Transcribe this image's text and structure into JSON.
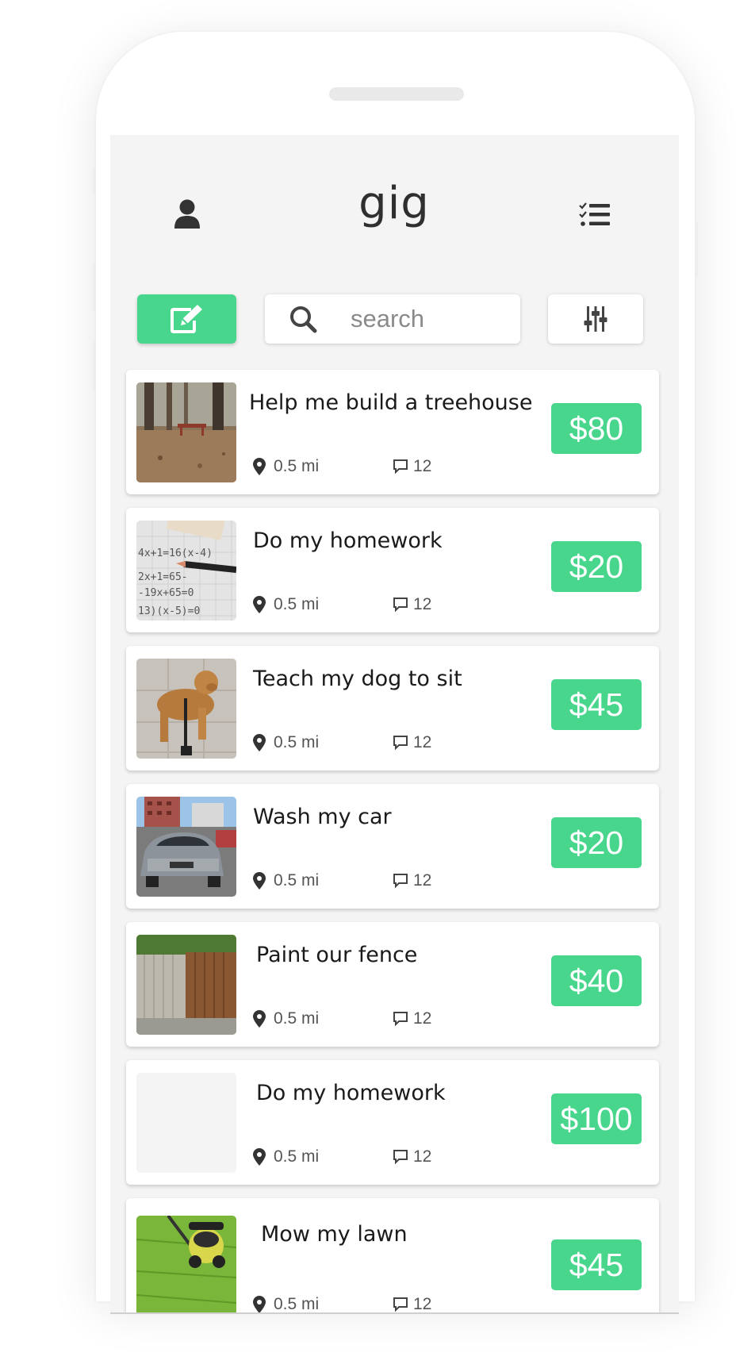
{
  "app": {
    "title": "gig"
  },
  "header": {
    "profile_icon": "user-icon",
    "tasks_icon": "checklist-icon"
  },
  "toolbar": {
    "compose_icon": "edit-icon",
    "search_placeholder": "search",
    "filter_icon": "sliders-icon"
  },
  "colors": {
    "accent": "#47d68c",
    "screen_bg": "#f4f4f4",
    "card_bg": "#ffffff",
    "text_dark": "#1a1a1a",
    "text_muted": "#555555"
  },
  "gigs": [
    {
      "title": "Help me build a treehouse",
      "distance": "0.5 mi",
      "comments": "12",
      "price": "$80",
      "image": "forest-picnic-table"
    },
    {
      "title": "Do my homework",
      "distance": "0.5 mi",
      "comments": "12",
      "price": "$20",
      "image": "math-paper-pencil"
    },
    {
      "title": "Teach my dog to sit",
      "distance": "0.5 mi",
      "comments": "12",
      "price": "$45",
      "image": "golden-retriever"
    },
    {
      "title": "Wash my car",
      "distance": "0.5 mi",
      "comments": "12",
      "price": "$20",
      "image": "silver-car"
    },
    {
      "title": "Paint our fence",
      "distance": "0.5 mi",
      "comments": "12",
      "price": "$40",
      "image": "wooden-fence"
    },
    {
      "title": "Do my homework",
      "distance": "0.5 mi",
      "comments": "12",
      "price": "$100",
      "image": "blank"
    },
    {
      "title": "Mow my lawn",
      "distance": "0.5 mi",
      "comments": "12",
      "price": "$45",
      "image": "lawn-mower"
    }
  ]
}
